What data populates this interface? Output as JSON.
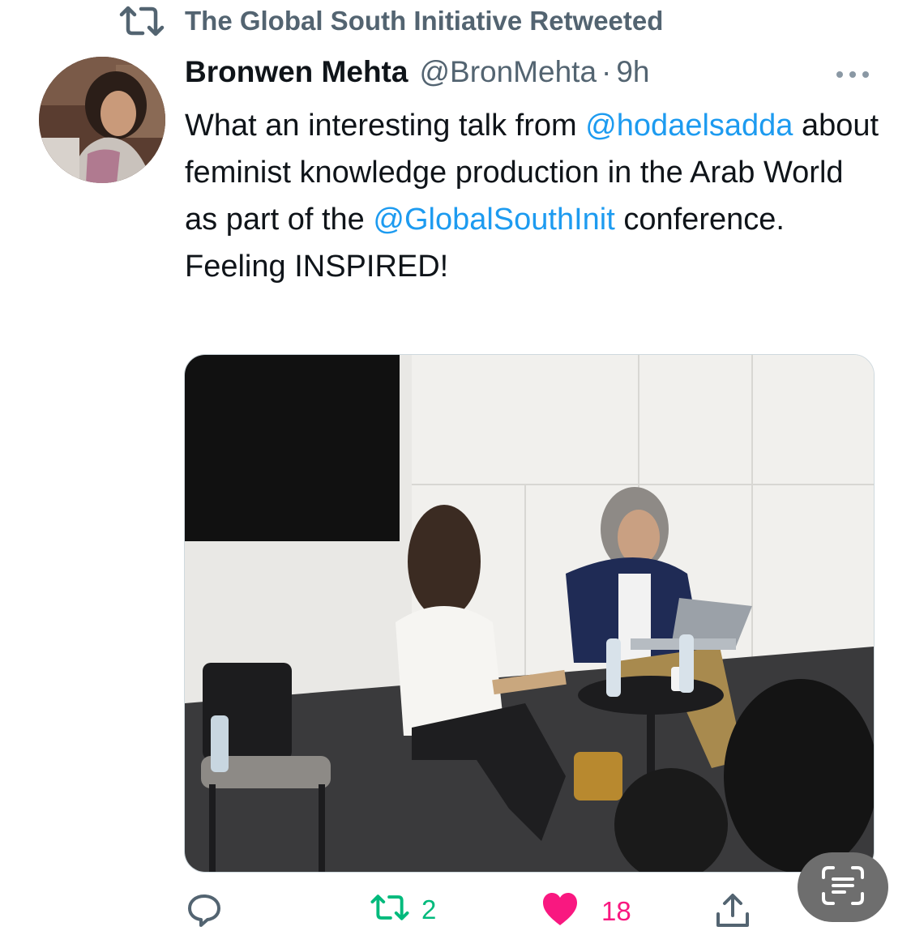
{
  "retweet_banner": {
    "text": "The Global South Initiative Retweeted",
    "icon": "retweet-icon"
  },
  "tweet": {
    "author_name": "Bronwen Mehta",
    "author_handle": "@BronMehta",
    "separator": "·",
    "time": "9h",
    "text_segments": [
      {
        "text": "What an interesting talk from ",
        "mention": false
      },
      {
        "text": "@hodaelsadda",
        "mention": true
      },
      {
        "text": " about feminist knowledge production in the Arab World as part of the ",
        "mention": false
      },
      {
        "text": "@GlobalSouthInit",
        "mention": true
      },
      {
        "text": " conference. Feeling INSPIRED!",
        "mention": false
      }
    ],
    "photo_alt": "Two women seated on a panel in a conference room, one speaking with a laptop"
  },
  "actions": {
    "reply": {
      "icon": "reply-icon"
    },
    "retweet": {
      "icon": "retweet-icon",
      "count": "2"
    },
    "like": {
      "icon": "heart-icon",
      "count": "18"
    },
    "share": {
      "icon": "share-icon"
    }
  },
  "overlay": {
    "icon": "text-scan-icon"
  },
  "colors": {
    "accent": "#1d9bf0",
    "secondary_text": "#536471",
    "retweet_green": "#00ba7c",
    "like_pink": "#f91880"
  }
}
